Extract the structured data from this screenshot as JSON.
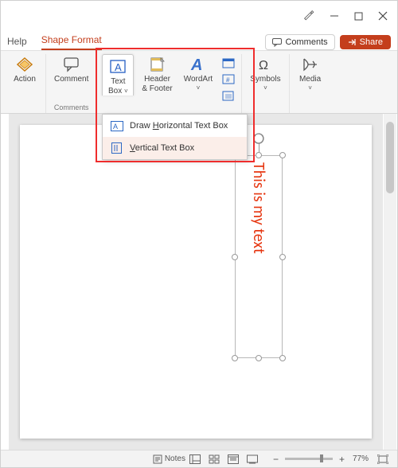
{
  "titlebar": {
    "pen_icon": "pen-icon"
  },
  "tabs": {
    "help": "Help",
    "shape_format": "Shape Format"
  },
  "header": {
    "comments": "Comments",
    "share": "Share"
  },
  "ribbon": {
    "action": "Action",
    "comment": "Comment",
    "text_box": "Text",
    "text_box_line2": "Box",
    "header_footer": "Header",
    "header_footer_line2": "& Footer",
    "wordart": "WordArt",
    "symbols": "Symbols",
    "media": "Media",
    "group_comments": "Comments"
  },
  "dropdown": {
    "horizontal": "Draw Horizontal Text Box",
    "horizontal_key": "H",
    "vertical": "Vertical Text Box",
    "vertical_key": "V"
  },
  "canvas": {
    "textbox_content": "This is my text"
  },
  "statusbar": {
    "notes": "Notes",
    "zoom": "77%"
  }
}
